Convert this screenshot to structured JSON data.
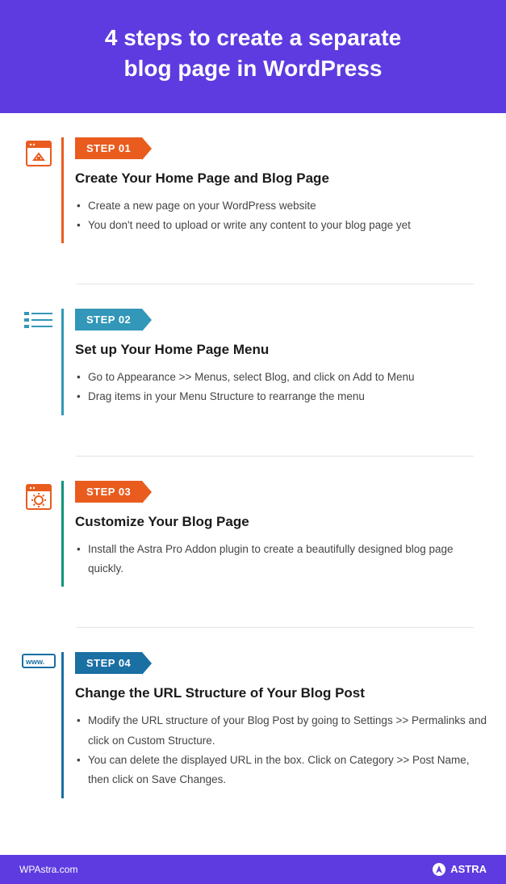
{
  "header": {
    "title_line1": "4 steps to create a separate",
    "title_line2": "blog page in WordPress"
  },
  "steps": [
    {
      "badge": "STEP 01",
      "title": "Create Your Home Page and Blog Page",
      "items": [
        "Create a new page on your WordPress website",
        "You don't need to upload or write any content to your blog page yet"
      ]
    },
    {
      "badge": "STEP 02",
      "title": "Set up Your Home Page Menu",
      "items": [
        "Go to Appearance >> Menus, select Blog, and click on Add to Menu",
        "Drag items in your Menu Structure to rearrange the menu"
      ]
    },
    {
      "badge": "STEP 03",
      "title": "Customize Your Blog Page",
      "items": [
        "Install the Astra Pro Addon plugin to create a beautifully designed blog page quickly."
      ]
    },
    {
      "badge": "STEP 04",
      "title": "Change the URL Structure of Your Blog Post",
      "items": [
        "Modify the URL structure of your Blog Post by going to Settings >> Permalinks and click on Custom Structure.",
        "You can delete the displayed URL in the box. Click on Category >> Post Name, then click on Save Changes."
      ]
    }
  ],
  "footer": {
    "site": "WPAstra.com",
    "brand": "ASTRA"
  }
}
